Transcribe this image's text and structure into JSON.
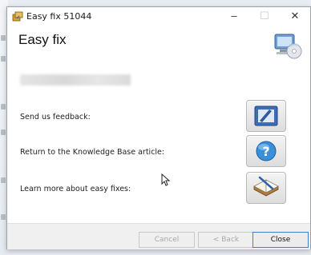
{
  "window": {
    "title": "Easy fix 51044",
    "controls": {
      "minimize": "–",
      "maximize": "☐",
      "close": "✕"
    }
  },
  "header": {
    "title": "Easy fix"
  },
  "options": [
    {
      "label": "Send us feedback:",
      "icon": "feedback-icon"
    },
    {
      "label": "Return to the Knowledge Base article:",
      "icon": "help-icon"
    },
    {
      "label": "Learn more about easy fixes:",
      "icon": "book-icon"
    }
  ],
  "footer": {
    "cancel": "Cancel",
    "back": "< Back",
    "close": "Close"
  },
  "colors": {
    "accent": "#3c7fd1",
    "disabled_text": "#a9a9a9"
  }
}
